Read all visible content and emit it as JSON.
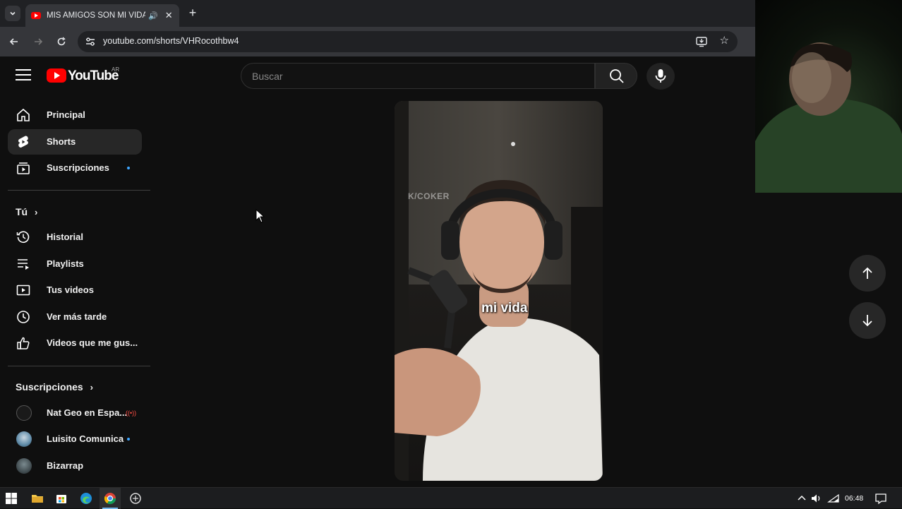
{
  "browser": {
    "tab_title": "MIS AMIGOS SON MI VIDA",
    "url": "youtube.com/shorts/VHRocothbw4"
  },
  "youtube": {
    "wordmark": "YouTube",
    "country_code": "AR",
    "search_placeholder": "Buscar"
  },
  "sidebar": {
    "main": [
      {
        "label": "Principal",
        "icon": "home-icon"
      },
      {
        "label": "Shorts",
        "icon": "shorts-icon",
        "active": true
      },
      {
        "label": "Suscripciones",
        "icon": "subscriptions-icon"
      }
    ],
    "you_title": "Tú",
    "you": [
      {
        "label": "Historial",
        "icon": "history-icon"
      },
      {
        "label": "Playlists",
        "icon": "playlists-icon"
      },
      {
        "label": "Tus videos",
        "icon": "your-videos-icon"
      },
      {
        "label": "Ver más tarde",
        "icon": "watch-later-icon"
      },
      {
        "label": "Videos que me gus...",
        "icon": "liked-videos-icon"
      }
    ],
    "subs_title": "Suscripciones",
    "subscriptions": [
      {
        "label": "Nat Geo en Espa...",
        "status": "live"
      },
      {
        "label": "Luisito Comunica",
        "status": "new"
      },
      {
        "label": "Bizarrap",
        "status": ""
      }
    ]
  },
  "short": {
    "caption": "mi vida",
    "watermark": "K/COKER"
  },
  "taskbar": {
    "time": "06:48"
  },
  "colors": {
    "brand_red": "#ff0000",
    "accent_blue": "#3ea6ff",
    "live_red": "#ff4e45"
  }
}
